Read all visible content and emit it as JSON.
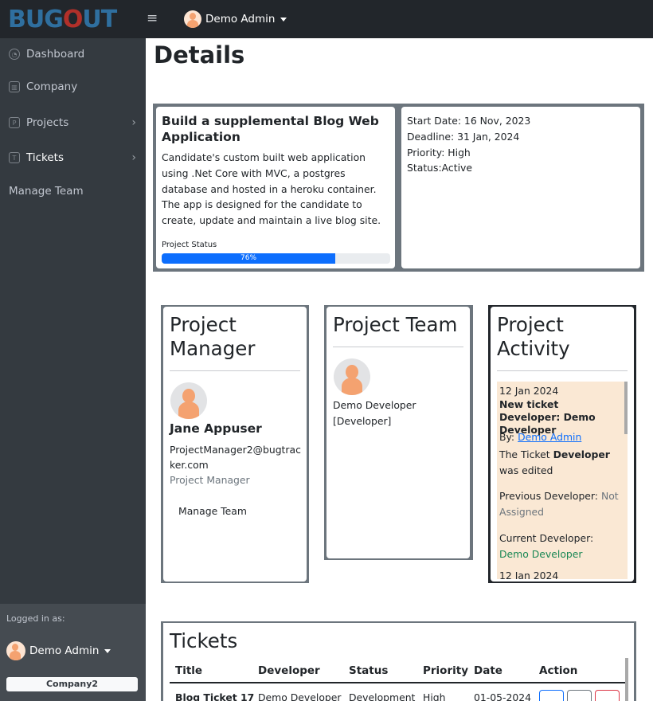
{
  "topbar": {
    "logo_text_pre": "BUG",
    "logo_text_o": "O",
    "logo_text_post": "UT",
    "menu_icon": "≡",
    "user_name": "Demo Admin"
  },
  "sidebar": {
    "items": [
      {
        "label": "Dashboard",
        "icon": "dashboard-icon"
      },
      {
        "label": "Company",
        "icon": "building-icon"
      },
      {
        "label": "Projects",
        "icon": "file-icon"
      },
      {
        "label": "Tickets",
        "icon": "ticket-icon"
      },
      {
        "label": "Manage Team"
      }
    ],
    "logged_in_label": "Logged in as:",
    "user_name": "Demo Admin",
    "company_button": "Company2"
  },
  "main": {
    "page_title": "Details",
    "project": {
      "title": "Build a supplemental Blog Web Application",
      "description": "Candidate's custom built web application using .Net Core with MVC, a postgres database and hosted in a heroku container. The app is designed for the candidate to create, update and maintain a live blog site.",
      "status_label": "Project Status",
      "progress_percent": 76,
      "progress_label": "76%",
      "start_date": "Start Date: 16 Nov, 2023",
      "deadline": "Deadline: 31 Jan, 2024",
      "priority": "Priority: High",
      "status": "Status:Active"
    },
    "manager_panel": {
      "title": "Project Manager",
      "name": "Jane Appuser",
      "email": "ProjectManager2@bugtracker.com",
      "role": "Project Manager",
      "manage_link": "Manage Team"
    },
    "team_panel": {
      "title": "Project Team",
      "member_name": "Demo Developer",
      "member_role": "[Developer]"
    },
    "activity_panel": {
      "title": "Project Activity",
      "entries": [
        {
          "date": "12 Jan 2024",
          "title": "New ticket Developer: Demo Developer",
          "by_label": "By:",
          "by_user": "Demo Admin",
          "edited_pre": "The Ticket",
          "edited_bold": "Developer",
          "edited_post": "was edited",
          "previous_label": "Previous Developer:",
          "previous_value": "Not Assigned",
          "current_label": "Current Developer:",
          "current_value": "Demo Developer"
        },
        {
          "date": "12 Jan 2024"
        }
      ]
    },
    "tickets": {
      "title": "Tickets",
      "columns": [
        "Title",
        "Developer",
        "Status",
        "Priority",
        "Date",
        "Action"
      ],
      "rows": [
        {
          "title": "Blog Ticket 17",
          "developer": "Demo Developer",
          "status": "Development",
          "priority": "High",
          "date": "01-05-2024"
        }
      ]
    }
  }
}
